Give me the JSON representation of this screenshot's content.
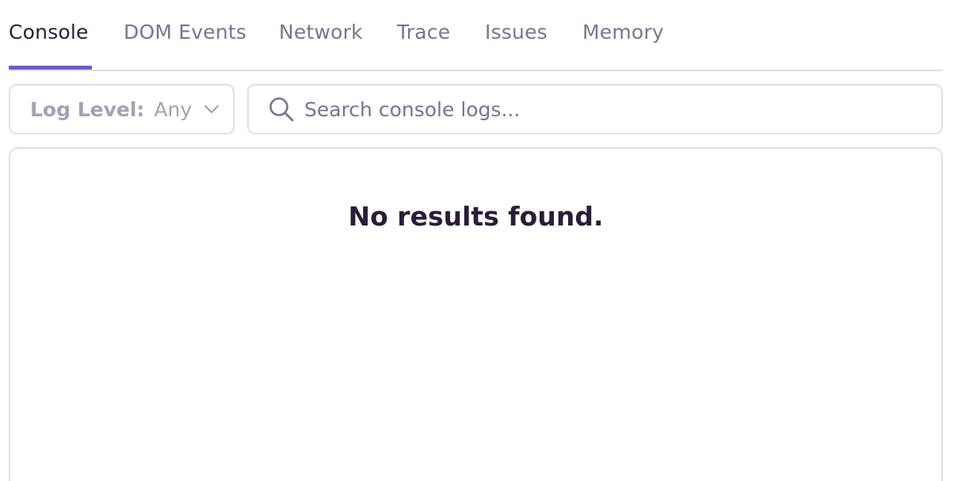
{
  "tabs": [
    {
      "label": "Console",
      "active": true
    },
    {
      "label": "DOM Events",
      "active": false
    },
    {
      "label": "Network",
      "active": false
    },
    {
      "label": "Trace",
      "active": false
    },
    {
      "label": "Issues",
      "active": false
    },
    {
      "label": "Memory",
      "active": false
    }
  ],
  "filters": {
    "log_level_label": "Log Level:",
    "log_level_value": "Any",
    "search_placeholder": "Search console logs..."
  },
  "results": {
    "empty_message": "No results found."
  },
  "colors": {
    "accent": "#6c5fc7",
    "text_primary": "#2b1d38",
    "text_muted": "#80708f",
    "border": "#e2dee6"
  },
  "icons": {
    "search": "search-icon",
    "chevron": "chevron-down-icon"
  }
}
